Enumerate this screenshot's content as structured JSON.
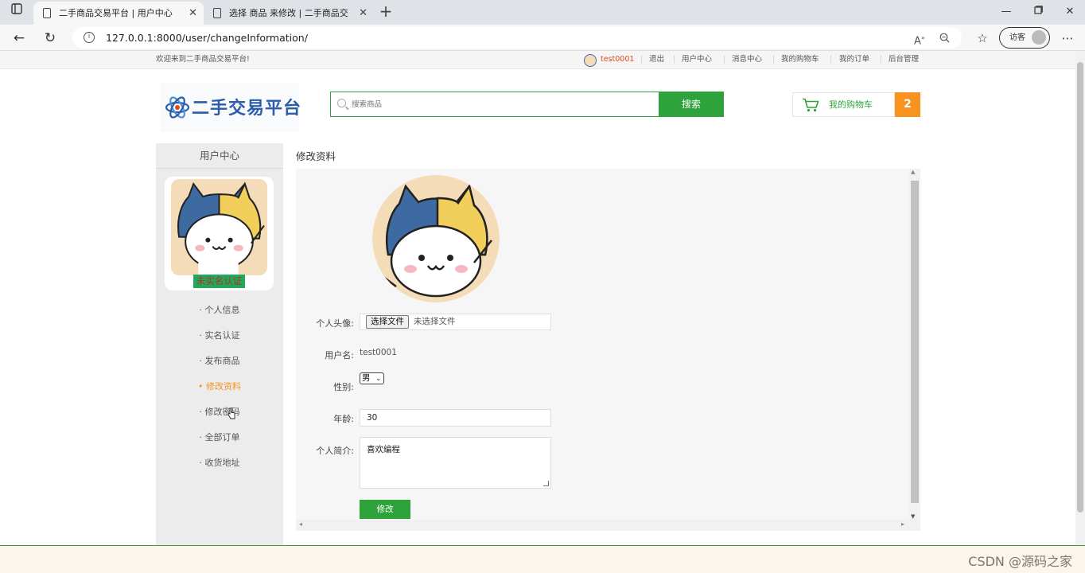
{
  "browser": {
    "tabs": [
      {
        "title": "二手商品交易平台 | 用户中心",
        "active": true
      },
      {
        "title": "选择 商品 来修改 | 二手商品交易",
        "active": false
      }
    ],
    "url": "127.0.0.1:8000/user/changeInformation/",
    "guest_label": "访客"
  },
  "topbar": {
    "welcome": "欢迎来到二手商品交易平台!",
    "username": "test0001",
    "links": [
      "退出",
      "用户中心",
      "消息中心",
      "我的购物车",
      "我的订单",
      "后台管理"
    ]
  },
  "header": {
    "logo_text": "二手交易平台",
    "search_placeholder": "搜索商品",
    "search_button": "搜索",
    "cart_label": "我的购物车",
    "cart_count": "2"
  },
  "sidebar": {
    "title": "用户中心",
    "cert_status": "未实名认证",
    "items": [
      {
        "label": "· 个人信息",
        "active": false
      },
      {
        "label": "· 实名认证",
        "active": false
      },
      {
        "label": "· 发布商品",
        "active": false
      },
      {
        "label": "• 修改资料",
        "active": true
      },
      {
        "label": "· 修改密码",
        "active": false
      },
      {
        "label": "· 全部订单",
        "active": false
      },
      {
        "label": "· 收货地址",
        "active": false
      }
    ]
  },
  "main": {
    "title": "修改资料",
    "form": {
      "avatar_label": "个人头像:",
      "file_button": "选择文件",
      "file_status": "未选择文件",
      "username_label": "用户名:",
      "username_value": "test0001",
      "gender_label": "性别:",
      "gender_value": "男",
      "age_label": "年龄:",
      "age_value": "30",
      "bio_label": "个人简介:",
      "bio_value": "喜欢编程",
      "submit": "修改"
    }
  },
  "watermark": "CSDN @源码之家",
  "colors": {
    "accent": "#2fa33b",
    "orange": "#f7931e"
  }
}
